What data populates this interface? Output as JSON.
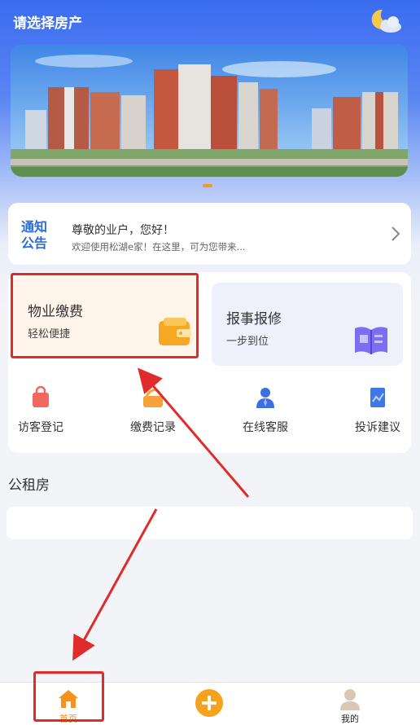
{
  "header": {
    "title": "请选择房产",
    "weather_icon": "moon-cloud-icon"
  },
  "banner": {
    "dots": 1,
    "active_dot_color": "#f49a26"
  },
  "notice": {
    "logo_text_line1": "通知",
    "logo_text_line2": "公告",
    "title": "尊敬的业户，您好！",
    "subtitle": "欢迎使用松湖e家！在这里，可为您带来..."
  },
  "services": {
    "property_fee": {
      "title": "物业缴费",
      "subtitle": "轻松便捷",
      "icon": "wallet-icon"
    },
    "repair": {
      "title": "报事报修",
      "subtitle": "一步到位",
      "icon": "book-icon"
    },
    "quick_links": [
      {
        "label": "访客登记",
        "icon": "visitor-bag-icon"
      },
      {
        "label": "缴费记录",
        "icon": "payment-record-icon"
      },
      {
        "label": "在线客服",
        "icon": "customer-service-icon"
      },
      {
        "label": "投诉建议",
        "icon": "complaint-icon"
      }
    ]
  },
  "public_housing": {
    "title": "公租房"
  },
  "tabbar": {
    "home_label": "首页",
    "add_icon": "plus-icon",
    "me_label": "我的"
  },
  "colors": {
    "accent_orange": "#f5921e",
    "header_blue": "#3a6cf0",
    "annotation_red": "#e02b2b"
  }
}
